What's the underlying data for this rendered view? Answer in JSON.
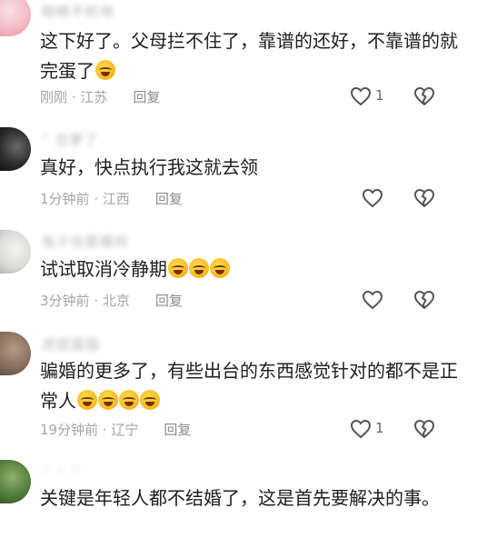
{
  "comments": [
    {
      "username": "眼睛不眨地",
      "text": "这下好了。父母拦不住了，靠谱的还好，不靠谱的就完蛋了",
      "emojis": 1,
      "time": "刚刚",
      "location": "江苏",
      "reply_label": "回复",
      "like_count": "1",
      "avatar_color": "#f2b7c2"
    },
    {
      "username": "“ 吉萝了",
      "text": "真好，快点执行我这就去领",
      "emojis": 0,
      "time": "1分钟前",
      "location": "江西",
      "reply_label": "回复",
      "like_count": "",
      "avatar_color": "#3a3a3a"
    },
    {
      "username": "兔子你那模样",
      "text": "试试取消冷静期",
      "emojis": 3,
      "time": "3分钟前",
      "location": "北京",
      "reply_label": "回复",
      "like_count": "",
      "avatar_color": "#dcdcd8"
    },
    {
      "username": "虎妞猫猫",
      "text": "骗婚的更多了，有些出台的东西感觉针对的都不是正常人",
      "emojis": 4,
      "time": "19分钟前",
      "location": "辽宁",
      "reply_label": "回复",
      "like_count": "1",
      "avatar_color": "#8a7260"
    },
    {
      "username": "∵ ∴ ∵",
      "text": "关键是年轻人都不结婚了，这是首先要解决的事。",
      "emojis": 0,
      "time": "",
      "location": "",
      "reply_label": "",
      "like_count": "",
      "avatar_color": "#4f7a3a"
    }
  ],
  "icons": {
    "like": "heart-outline-icon",
    "dislike": "broken-heart-icon"
  }
}
